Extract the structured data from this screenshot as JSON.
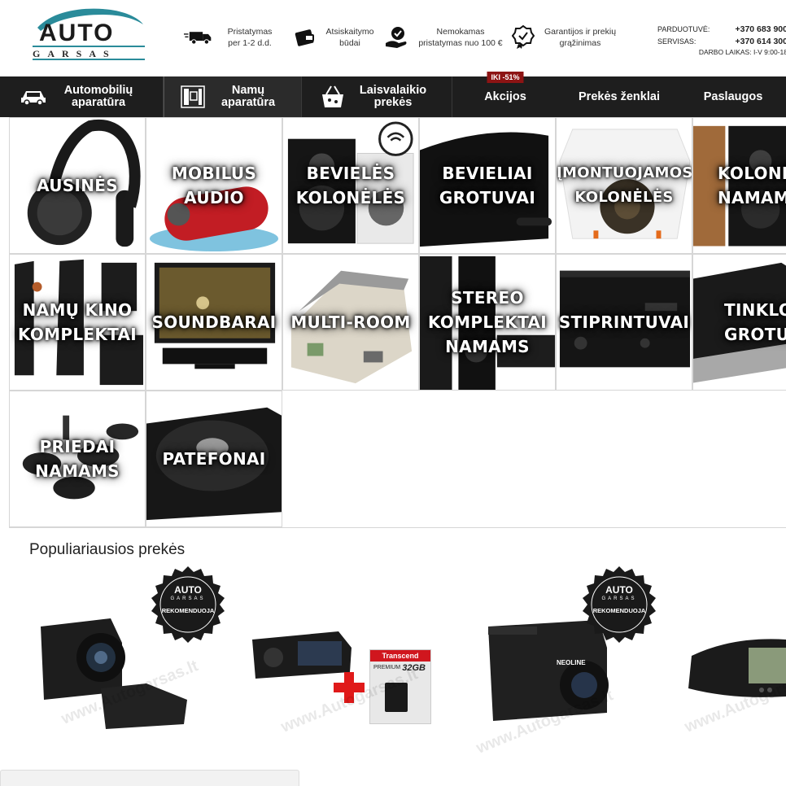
{
  "logo": {
    "word": "AUTO",
    "sub": "GARSAS"
  },
  "features": [
    {
      "icon": "truck-icon",
      "text": "Pristatymas per 1-2 d.d."
    },
    {
      "icon": "wallet-icon",
      "text": "Atsiskaitymo būdai"
    },
    {
      "icon": "hand-check-icon",
      "text": "Nemokamas pristatymas nuo 100 €"
    },
    {
      "icon": "guarantee-icon",
      "text": "Garantijos ir prekių grąžinimas"
    }
  ],
  "contacts": {
    "shop_label": "PARDUOTUVĖ:",
    "shop_phone": "+370 683 900",
    "service_label": "SERVISAS:",
    "service_phone": "+370 614 300",
    "hours": "DARBO LAIKAS: I-V 9:00-18"
  },
  "nav": [
    {
      "label": "Automobilių aparatūra",
      "icon": "car-icon"
    },
    {
      "label": "Namų aparatūra",
      "icon": "home-audio-icon"
    },
    {
      "label": "Laisvalaikio prekės",
      "icon": "basket-icon"
    },
    {
      "label": "Akcijos",
      "badge": "IKI -51%"
    },
    {
      "label": "Prekės ženklai"
    },
    {
      "label": "Paslaugos"
    }
  ],
  "categories": [
    {
      "line1": "AUSINĖS",
      "line2": "",
      "line3": ""
    },
    {
      "line1": "MOBILUS",
      "line2": "AUDIO",
      "line3": ""
    },
    {
      "line1": "BEVIELĖS",
      "line2": "KOLONĖLĖS",
      "line3": ""
    },
    {
      "line1": "BEVIELIAI",
      "line2": "GROTUVAI",
      "line3": ""
    },
    {
      "line1": "ĮMONTUOJAMOS",
      "line2": "KOLONĖLĖS",
      "line3": ""
    },
    {
      "line1": "KOLONĖLĖ",
      "line2": "NAMAMS",
      "line3": ""
    },
    {
      "line1": "NAMŲ KINO",
      "line2": "KOMPLEKTAI",
      "line3": ""
    },
    {
      "line1": "SOUNDBARAI",
      "line2": "",
      "line3": ""
    },
    {
      "line1": "MULTI-ROOM",
      "line2": "",
      "line3": ""
    },
    {
      "line1": "STEREO",
      "line2": "KOMPLEKTAI",
      "line3": "NAMAMS"
    },
    {
      "line1": "STIPRINTUVAI",
      "line2": "",
      "line3": ""
    },
    {
      "line1": "TINKLO",
      "line2": "GROTUVA",
      "line3": ""
    },
    {
      "line1": "PRIEDAI",
      "line2": "NAMAMS",
      "line3": ""
    },
    {
      "line1": "PATEFONAI",
      "line2": "",
      "line3": ""
    }
  ],
  "popular": {
    "title": "Populiariausios prekės",
    "seal_top": "AUTO",
    "seal_mid": "GARSAS",
    "seal_text": "REKOMENDUOJA",
    "watermark": "www.Autogarsas.lt",
    "sd_brand": "Transcend",
    "sd_label": "PREMIUM",
    "sd_size": "32GB",
    "device_brand": "NEOLINE"
  },
  "colors": {
    "nav_bg": "#1e1e1e",
    "badge": "#8d1414",
    "logo_teal": "#2a8b9a"
  }
}
